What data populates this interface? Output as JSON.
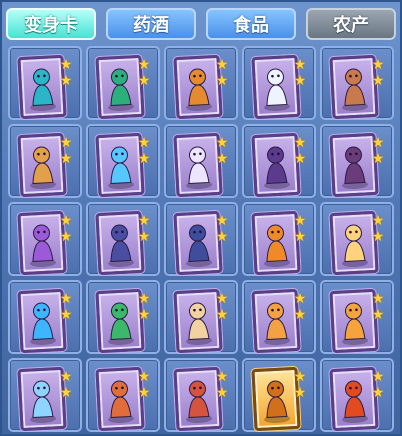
{
  "tabs": [
    {
      "label": "变身卡",
      "state": "active"
    },
    {
      "label": "药酒",
      "state": "normal"
    },
    {
      "label": "食品",
      "state": "normal"
    },
    {
      "label": "农产",
      "state": "disabled"
    }
  ],
  "star_glyph": "★",
  "cards": [
    {
      "icon": "warrior-figure-icon",
      "stars": 2,
      "frame": "purple",
      "accent": "#2bb6c8"
    },
    {
      "icon": "dancer-figure-icon",
      "stars": 2,
      "frame": "purple",
      "accent": "#2bb07d"
    },
    {
      "icon": "fox-spirit-icon",
      "stars": 2,
      "frame": "purple",
      "accent": "#e58a2e"
    },
    {
      "icon": "white-beast-icon",
      "stars": 2,
      "frame": "purple",
      "accent": "#eef4ff"
    },
    {
      "icon": "boar-icon",
      "stars": 2,
      "frame": "purple",
      "accent": "#c97a4c"
    },
    {
      "icon": "monkey-icon",
      "stars": 2,
      "frame": "purple",
      "accent": "#e2a04b"
    },
    {
      "icon": "ice-dragon-icon",
      "stars": 2,
      "frame": "purple",
      "accent": "#56c7ff"
    },
    {
      "icon": "winged-figure-icon",
      "stars": 2,
      "frame": "purple",
      "accent": "#ede4ff"
    },
    {
      "icon": "dark-knight-icon",
      "stars": 2,
      "frame": "purple",
      "accent": "#5c3a8e"
    },
    {
      "icon": "shadow-beast-icon",
      "stars": 2,
      "frame": "purple",
      "accent": "#6b3c7a"
    },
    {
      "icon": "sorceress-icon",
      "stars": 2,
      "frame": "purple",
      "accent": "#9d5ad8"
    },
    {
      "icon": "horse-rider-icon",
      "stars": 2,
      "frame": "purple",
      "accent": "#4a4ea2"
    },
    {
      "icon": "dark-horse-icon",
      "stars": 2,
      "frame": "purple",
      "accent": "#3f4e9c"
    },
    {
      "icon": "flame-fox-icon",
      "stars": 2,
      "frame": "purple",
      "accent": "#f08a28"
    },
    {
      "icon": "fairy-icon",
      "stars": 2,
      "frame": "purple",
      "accent": "#ffd37e"
    },
    {
      "icon": "water-spirit-icon",
      "stars": 2,
      "frame": "purple",
      "accent": "#3eb6ff"
    },
    {
      "icon": "green-warrior-icon",
      "stars": 2,
      "frame": "purple",
      "accent": "#3bb86a"
    },
    {
      "icon": "rabbit-warrior-icon",
      "stars": 2,
      "frame": "purple",
      "accent": "#f3d2a2"
    },
    {
      "icon": "tailed-fox-icon",
      "stars": 2,
      "frame": "purple",
      "accent": "#f2a243"
    },
    {
      "icon": "orange-fox-icon",
      "stars": 2,
      "frame": "purple",
      "accent": "#f4a43a"
    },
    {
      "icon": "ice-fairy-icon",
      "stars": 2,
      "frame": "purple",
      "accent": "#8fd4ff"
    },
    {
      "icon": "armored-boy-icon",
      "stars": 2,
      "frame": "purple",
      "accent": "#e06d3a"
    },
    {
      "icon": "crimson-dancer-icon",
      "stars": 2,
      "frame": "purple",
      "accent": "#d6533d"
    },
    {
      "icon": "golden-lion-icon",
      "stars": 2,
      "frame": "gold",
      "accent": "#d26f1a"
    },
    {
      "icon": "fire-bird-icon",
      "stars": 2,
      "frame": "purple",
      "accent": "#e24b1f"
    }
  ]
}
